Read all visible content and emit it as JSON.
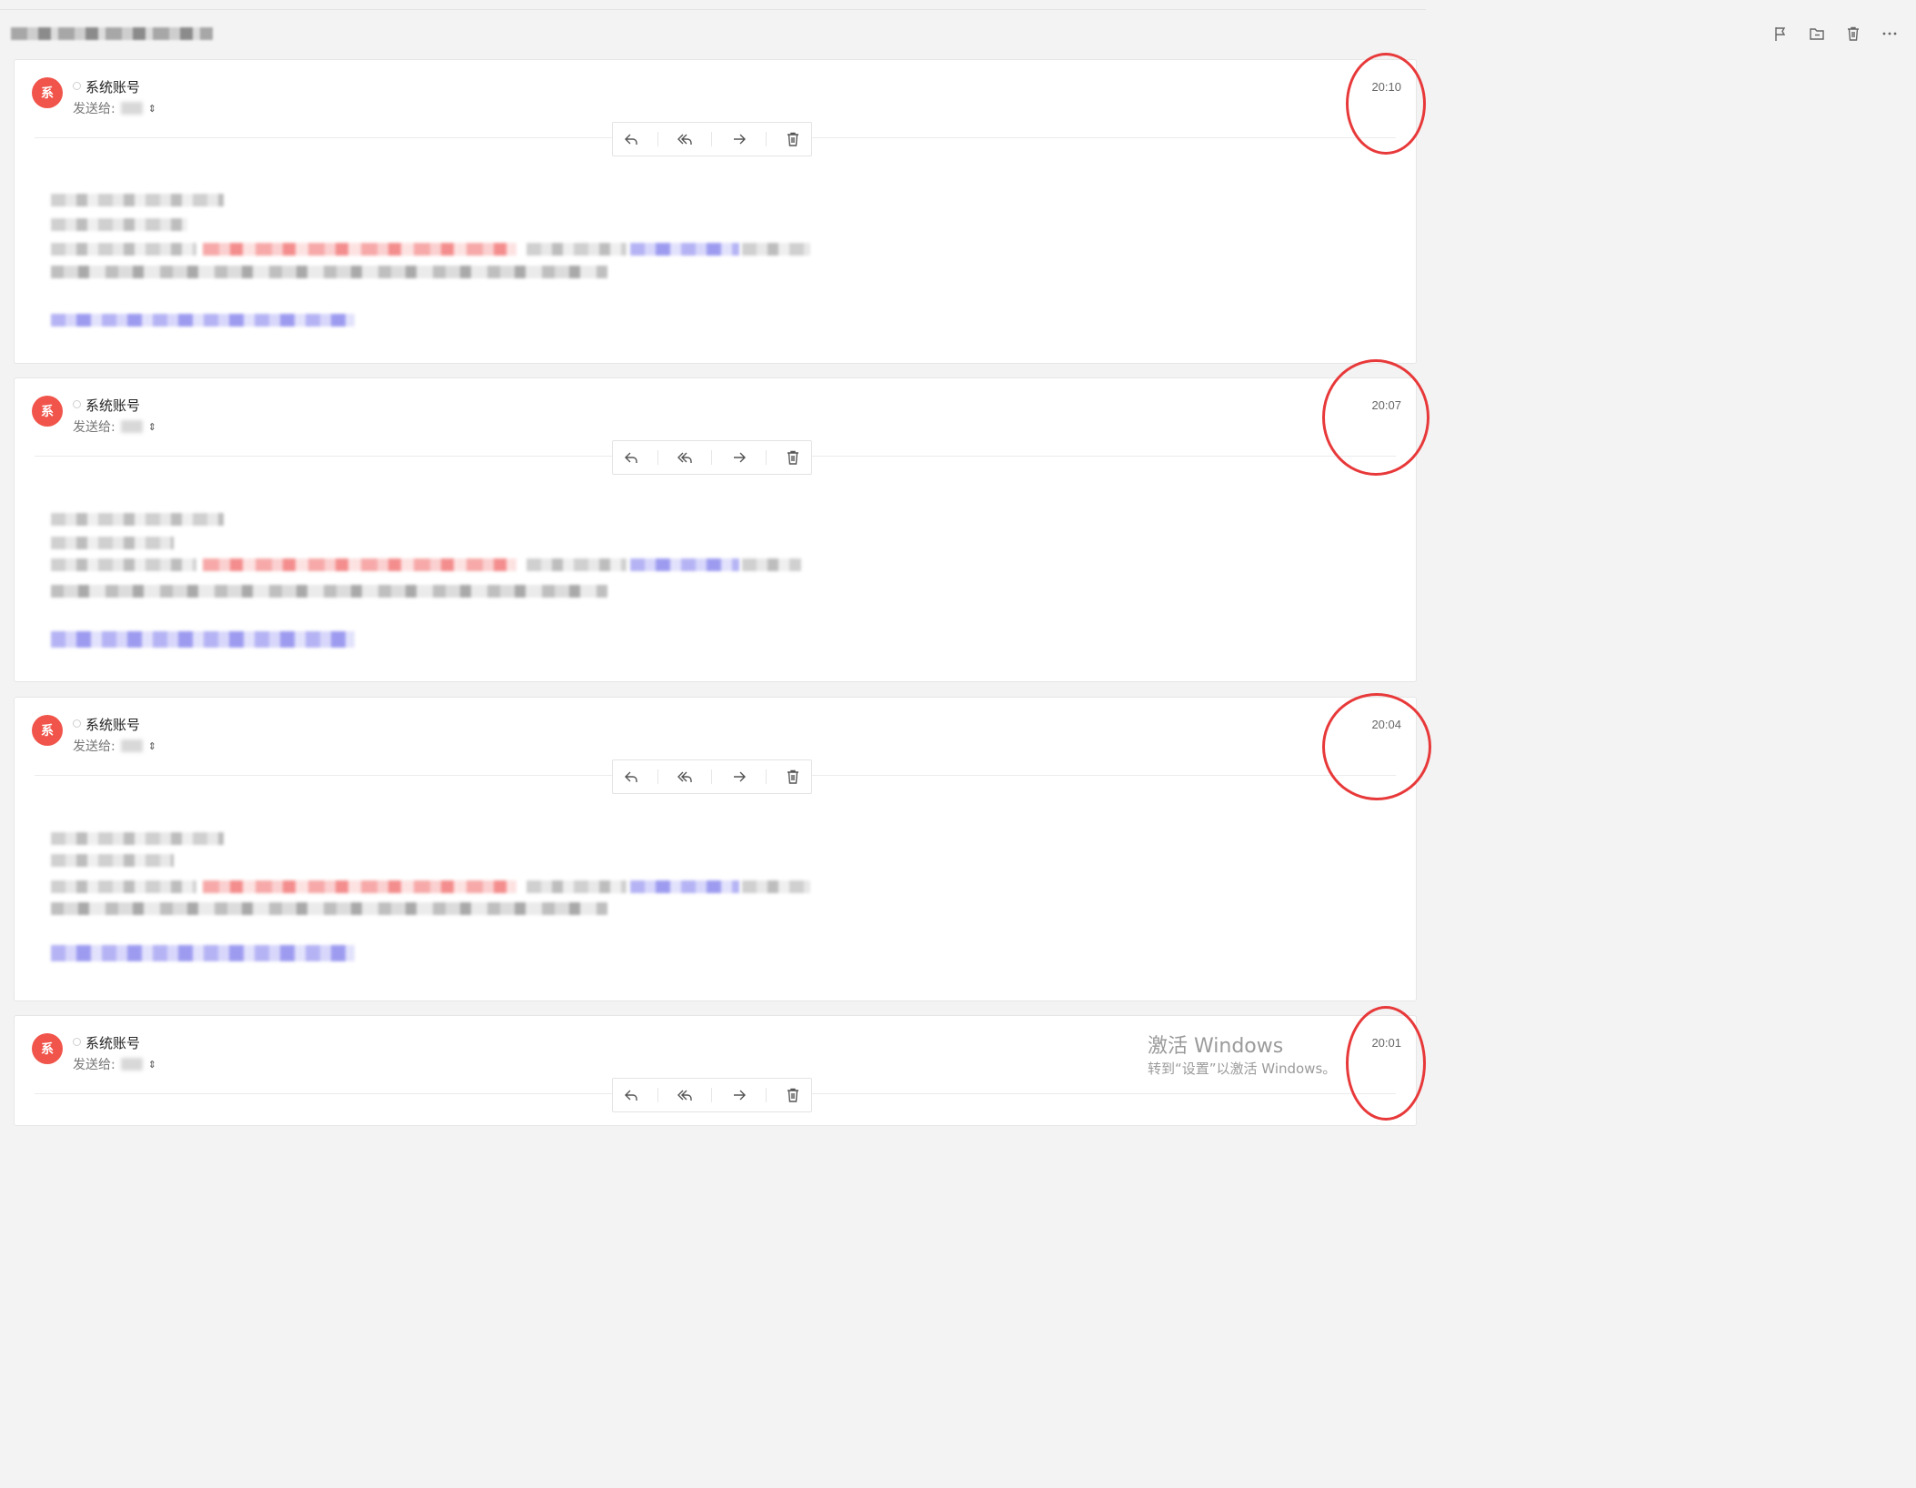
{
  "toolbar": {
    "icons": [
      "flag-icon",
      "move-to-folder-icon",
      "trash-icon",
      "more-icon"
    ]
  },
  "messages": [
    {
      "avatar": "系",
      "sender": "系统账号",
      "to_label": "发送给:",
      "time": "20:10"
    },
    {
      "avatar": "系",
      "sender": "系统账号",
      "to_label": "发送给:",
      "time": "20:07"
    },
    {
      "avatar": "系",
      "sender": "系统账号",
      "to_label": "发送给:",
      "time": "20:04"
    },
    {
      "avatar": "系",
      "sender": "系统账号",
      "to_label": "发送给:",
      "time": "20:01"
    }
  ],
  "message_actions": [
    "reply-icon",
    "reply-all-icon",
    "forward-icon",
    "delete-icon"
  ],
  "watermark": {
    "title": "激活 Windows",
    "subtitle": "转到“设置”以激活 Windows。"
  },
  "colors": {
    "avatar_bg": "#f0544a",
    "annotation_circle": "#e8393a"
  }
}
